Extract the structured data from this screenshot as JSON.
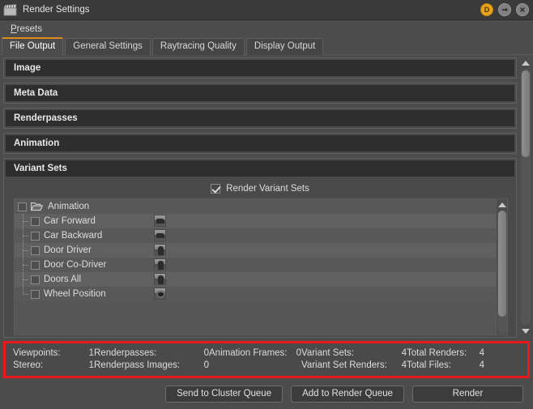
{
  "window": {
    "title": "Render Settings",
    "app_icon": "clapperboard-icon",
    "buttons": [
      {
        "name": "dock-button",
        "label": "D"
      },
      {
        "name": "detach-button",
        "label": "→"
      },
      {
        "name": "close-button",
        "label": "✕"
      }
    ]
  },
  "menubar": {
    "items": [
      {
        "label": "Presets",
        "mnemonic": "P",
        "rest": "resets"
      }
    ]
  },
  "tabs": [
    {
      "label": "File Output",
      "active": true
    },
    {
      "label": "General Settings",
      "active": false
    },
    {
      "label": "Raytracing Quality",
      "active": false
    },
    {
      "label": "Display Output",
      "active": false
    }
  ],
  "sections": [
    {
      "title": "Image",
      "expanded": false
    },
    {
      "title": "Meta Data",
      "expanded": false
    },
    {
      "title": "Renderpasses",
      "expanded": false
    },
    {
      "title": "Animation",
      "expanded": false
    },
    {
      "title": "Variant Sets",
      "expanded": true
    }
  ],
  "variant_sets": {
    "render_checkbox": {
      "label": "Render Variant Sets",
      "checked": true
    },
    "tree": {
      "root": {
        "label": "Animation",
        "checked": false,
        "icon": "folder-open-icon"
      },
      "children": [
        {
          "label": "Car Forward",
          "checked": false,
          "thumb": "car-forward-thumbnail"
        },
        {
          "label": "Car Backward",
          "checked": false,
          "thumb": "car-backward-thumbnail"
        },
        {
          "label": "Door Driver",
          "checked": false,
          "thumb": "door-driver-thumbnail"
        },
        {
          "label": "Door Co-Driver",
          "checked": false,
          "thumb": "door-co-driver-thumbnail"
        },
        {
          "label": "Doors All",
          "checked": false,
          "thumb": "doors-all-thumbnail"
        },
        {
          "label": "Wheel Position",
          "checked": false,
          "thumb": "wheel-position-thumbnail"
        }
      ]
    }
  },
  "stats": {
    "highlight_color": "#e81919",
    "row1": [
      {
        "label": "Viewpoints:",
        "value": "1"
      },
      {
        "label": "Renderpasses:",
        "value": "0"
      },
      {
        "label": "Animation Frames:",
        "value": "0"
      },
      {
        "label": "Variant Sets:",
        "value": "4"
      },
      {
        "label": "Total Renders:",
        "value": "4"
      }
    ],
    "row2": [
      {
        "label": "Stereo:",
        "value": "1"
      },
      {
        "label": "Renderpass Images:",
        "value": "0"
      },
      {
        "label": "",
        "value": ""
      },
      {
        "label": "Variant Set Renders:",
        "value": "4"
      },
      {
        "label": "Total Files:",
        "value": "4"
      }
    ]
  },
  "footer_buttons": [
    {
      "label": "Send to Cluster Queue"
    },
    {
      "label": "Add to Render Queue"
    },
    {
      "label": "Render"
    }
  ]
}
